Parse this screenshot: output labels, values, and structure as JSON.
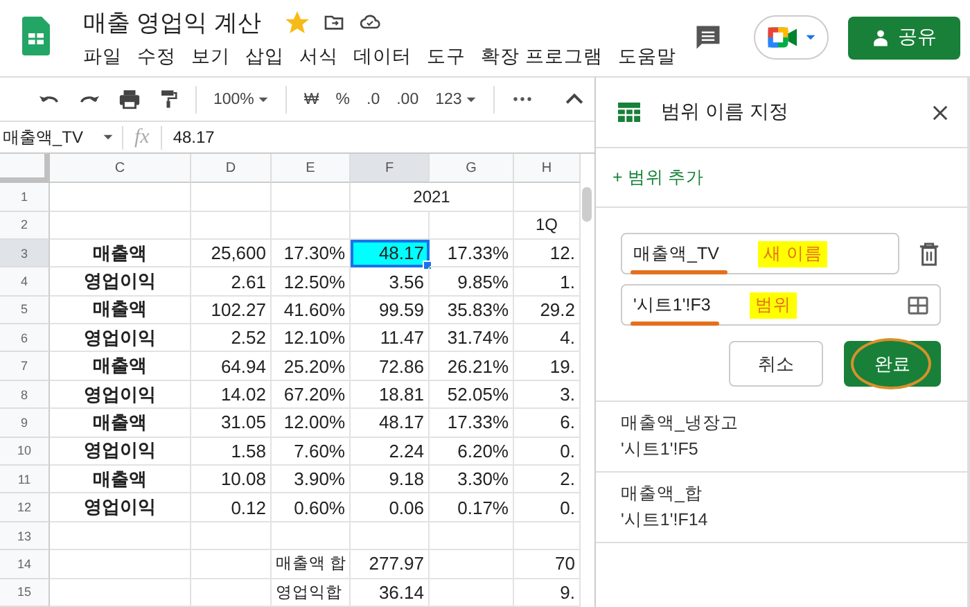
{
  "document": {
    "title": "매출 영업익 계산",
    "starred": true
  },
  "menu": [
    "파일",
    "수정",
    "보기",
    "삽입",
    "서식",
    "데이터",
    "도구",
    "확장 프로그램",
    "도움말"
  ],
  "share_button": {
    "label": "공유"
  },
  "toolbar": {
    "zoom": "100%",
    "currency": "₩",
    "percent": "%",
    "decrease_decimal": ".0",
    "increase_decimal": ".00",
    "number_format": "123"
  },
  "formula_bar": {
    "name_box": "매출액_TV",
    "fx": "fx",
    "value": "48.17"
  },
  "grid": {
    "columns": [
      "C",
      "D",
      "E",
      "F",
      "G",
      "H"
    ],
    "rows": [
      {
        "number": "1",
        "cells": [
          {
            "selected": false
          },
          {
            "selected": false
          },
          {
            "selected": false
          },
          {
            "kind": "header",
            "text": "2021",
            "merged": true,
            "selected": false
          },
          {
            "selected": false
          }
        ]
      },
      {
        "number": "2",
        "cells": [
          {
            "selected": false
          },
          {
            "selected": false
          },
          {
            "selected": false
          },
          {
            "selected": false
          },
          {
            "selected": false
          },
          {
            "kind": "header",
            "text": "1Q",
            "selected": false
          }
        ]
      },
      {
        "number": "3",
        "cells": [
          {
            "kind": "label",
            "text": "매출액",
            "selected": false
          },
          {
            "kind": "number",
            "text": "25,600",
            "selected": false
          },
          {
            "kind": "number",
            "text": "17.30%",
            "selected": false
          },
          {
            "kind": "number",
            "text": "48.17",
            "selected": true
          },
          {
            "kind": "number",
            "text": "17.33%",
            "selected": false
          },
          {
            "kind": "number",
            "text": "12.",
            "selected": false
          }
        ]
      },
      {
        "number": "4",
        "cells": [
          {
            "kind": "label",
            "text": "영업이익",
            "selected": false
          },
          {
            "kind": "number",
            "text": "2.61",
            "selected": false
          },
          {
            "kind": "number",
            "text": "12.50%",
            "selected": false
          },
          {
            "kind": "number",
            "text": "3.56",
            "selected": false
          },
          {
            "kind": "number",
            "text": "9.85%",
            "selected": false
          },
          {
            "kind": "number",
            "text": "1.",
            "selected": false
          }
        ]
      },
      {
        "number": "5",
        "cells": [
          {
            "kind": "label",
            "text": "매출액",
            "selected": false
          },
          {
            "kind": "number",
            "text": "102.27",
            "selected": false
          },
          {
            "kind": "number",
            "text": "41.60%",
            "selected": false
          },
          {
            "kind": "number",
            "text": "99.59",
            "selected": false
          },
          {
            "kind": "number",
            "text": "35.83%",
            "selected": false
          },
          {
            "kind": "number",
            "text": "29.2",
            "selected": false
          }
        ]
      },
      {
        "number": "6",
        "cells": [
          {
            "kind": "label",
            "text": "영업이익",
            "selected": false
          },
          {
            "kind": "number",
            "text": "2.52",
            "selected": false
          },
          {
            "kind": "number",
            "text": "12.10%",
            "selected": false
          },
          {
            "kind": "number",
            "text": "11.47",
            "selected": false
          },
          {
            "kind": "number",
            "text": "31.74%",
            "selected": false
          },
          {
            "kind": "number",
            "text": "4.",
            "selected": false
          }
        ]
      },
      {
        "number": "7",
        "cells": [
          {
            "kind": "label",
            "text": "매출액",
            "selected": false
          },
          {
            "kind": "number",
            "text": "64.94",
            "selected": false
          },
          {
            "kind": "number",
            "text": "25.20%",
            "selected": false
          },
          {
            "kind": "number",
            "text": "72.86",
            "selected": false
          },
          {
            "kind": "number",
            "text": "26.21%",
            "selected": false
          },
          {
            "kind": "number",
            "text": "19.",
            "selected": false
          }
        ]
      },
      {
        "number": "8",
        "cells": [
          {
            "kind": "label",
            "text": "영업이익",
            "selected": false
          },
          {
            "kind": "number",
            "text": "14.02",
            "selected": false
          },
          {
            "kind": "number",
            "text": "67.20%",
            "selected": false
          },
          {
            "kind": "number",
            "text": "18.81",
            "selected": false
          },
          {
            "kind": "number",
            "text": "52.05%",
            "selected": false
          },
          {
            "kind": "number",
            "text": "3.",
            "selected": false
          }
        ]
      },
      {
        "number": "9",
        "cells": [
          {
            "kind": "label",
            "text": "매출액",
            "selected": false
          },
          {
            "kind": "number",
            "text": "31.05",
            "selected": false
          },
          {
            "kind": "number",
            "text": "12.00%",
            "selected": false
          },
          {
            "kind": "number",
            "text": "48.17",
            "selected": false
          },
          {
            "kind": "number",
            "text": "17.33%",
            "selected": false
          },
          {
            "kind": "number",
            "text": "6.",
            "selected": false
          }
        ]
      },
      {
        "number": "10",
        "cells": [
          {
            "kind": "label",
            "text": "영업이익",
            "selected": false
          },
          {
            "kind": "number",
            "text": "1.58",
            "selected": false
          },
          {
            "kind": "number",
            "text": "7.60%",
            "selected": false
          },
          {
            "kind": "number",
            "text": "2.24",
            "selected": false
          },
          {
            "kind": "number",
            "text": "6.20%",
            "selected": false
          },
          {
            "kind": "number",
            "text": "0.",
            "selected": false
          }
        ]
      },
      {
        "number": "11",
        "cells": [
          {
            "kind": "label",
            "text": "매출액",
            "selected": false
          },
          {
            "kind": "number",
            "text": "10.08",
            "selected": false
          },
          {
            "kind": "number",
            "text": "3.90%",
            "selected": false
          },
          {
            "kind": "number",
            "text": "9.18",
            "selected": false
          },
          {
            "kind": "number",
            "text": "3.30%",
            "selected": false
          },
          {
            "kind": "number",
            "text": "2.",
            "selected": false
          }
        ]
      },
      {
        "number": "12",
        "cells": [
          {
            "kind": "label",
            "text": "영업이익",
            "selected": false
          },
          {
            "kind": "number",
            "text": "0.12",
            "selected": false
          },
          {
            "kind": "number",
            "text": "0.60%",
            "selected": false
          },
          {
            "kind": "number",
            "text": "0.06",
            "selected": false
          },
          {
            "kind": "number",
            "text": "0.17%",
            "selected": false
          },
          {
            "kind": "number",
            "text": "0.",
            "selected": false
          }
        ]
      },
      {
        "number": "13",
        "cells": [
          {
            "selected": false
          },
          {
            "selected": false
          },
          {
            "selected": false
          },
          {
            "selected": false
          },
          {
            "selected": false
          },
          {
            "selected": false
          }
        ]
      },
      {
        "number": "14",
        "cells": [
          {
            "selected": false
          },
          {
            "selected": false
          },
          {
            "kind": "sum-label",
            "text": "매출액 합",
            "selected": false
          },
          {
            "kind": "number",
            "text": "277.97",
            "selected": false
          },
          {
            "selected": false
          },
          {
            "kind": "number",
            "text": "70",
            "selected": false
          }
        ]
      },
      {
        "number": "15",
        "cells": [
          {
            "selected": false
          },
          {
            "selected": false
          },
          {
            "kind": "sum-label",
            "text": "영업익합",
            "selected": false
          },
          {
            "kind": "number",
            "text": "36.14",
            "selected": false
          },
          {
            "selected": false
          },
          {
            "kind": "number",
            "text": "9.",
            "selected": false
          }
        ]
      }
    ]
  },
  "named_ranges_panel": {
    "title": "범위 이름 지정",
    "add_link": "+ 범위 추가",
    "name_field": {
      "value": "매출액_TV",
      "annotation": "새 이름"
    },
    "range_field": {
      "value": "'시트1'!F3",
      "annotation": "범위"
    },
    "buttons": [
      {
        "label": "취소",
        "kind": "secondary"
      },
      {
        "label": "완료",
        "kind": "primary"
      }
    ],
    "ranges": [
      {
        "name": "매출액_냉장고",
        "range": "'시트1'!F5"
      },
      {
        "name": "매출액_합",
        "range": "'시트1'!F14"
      }
    ]
  }
}
